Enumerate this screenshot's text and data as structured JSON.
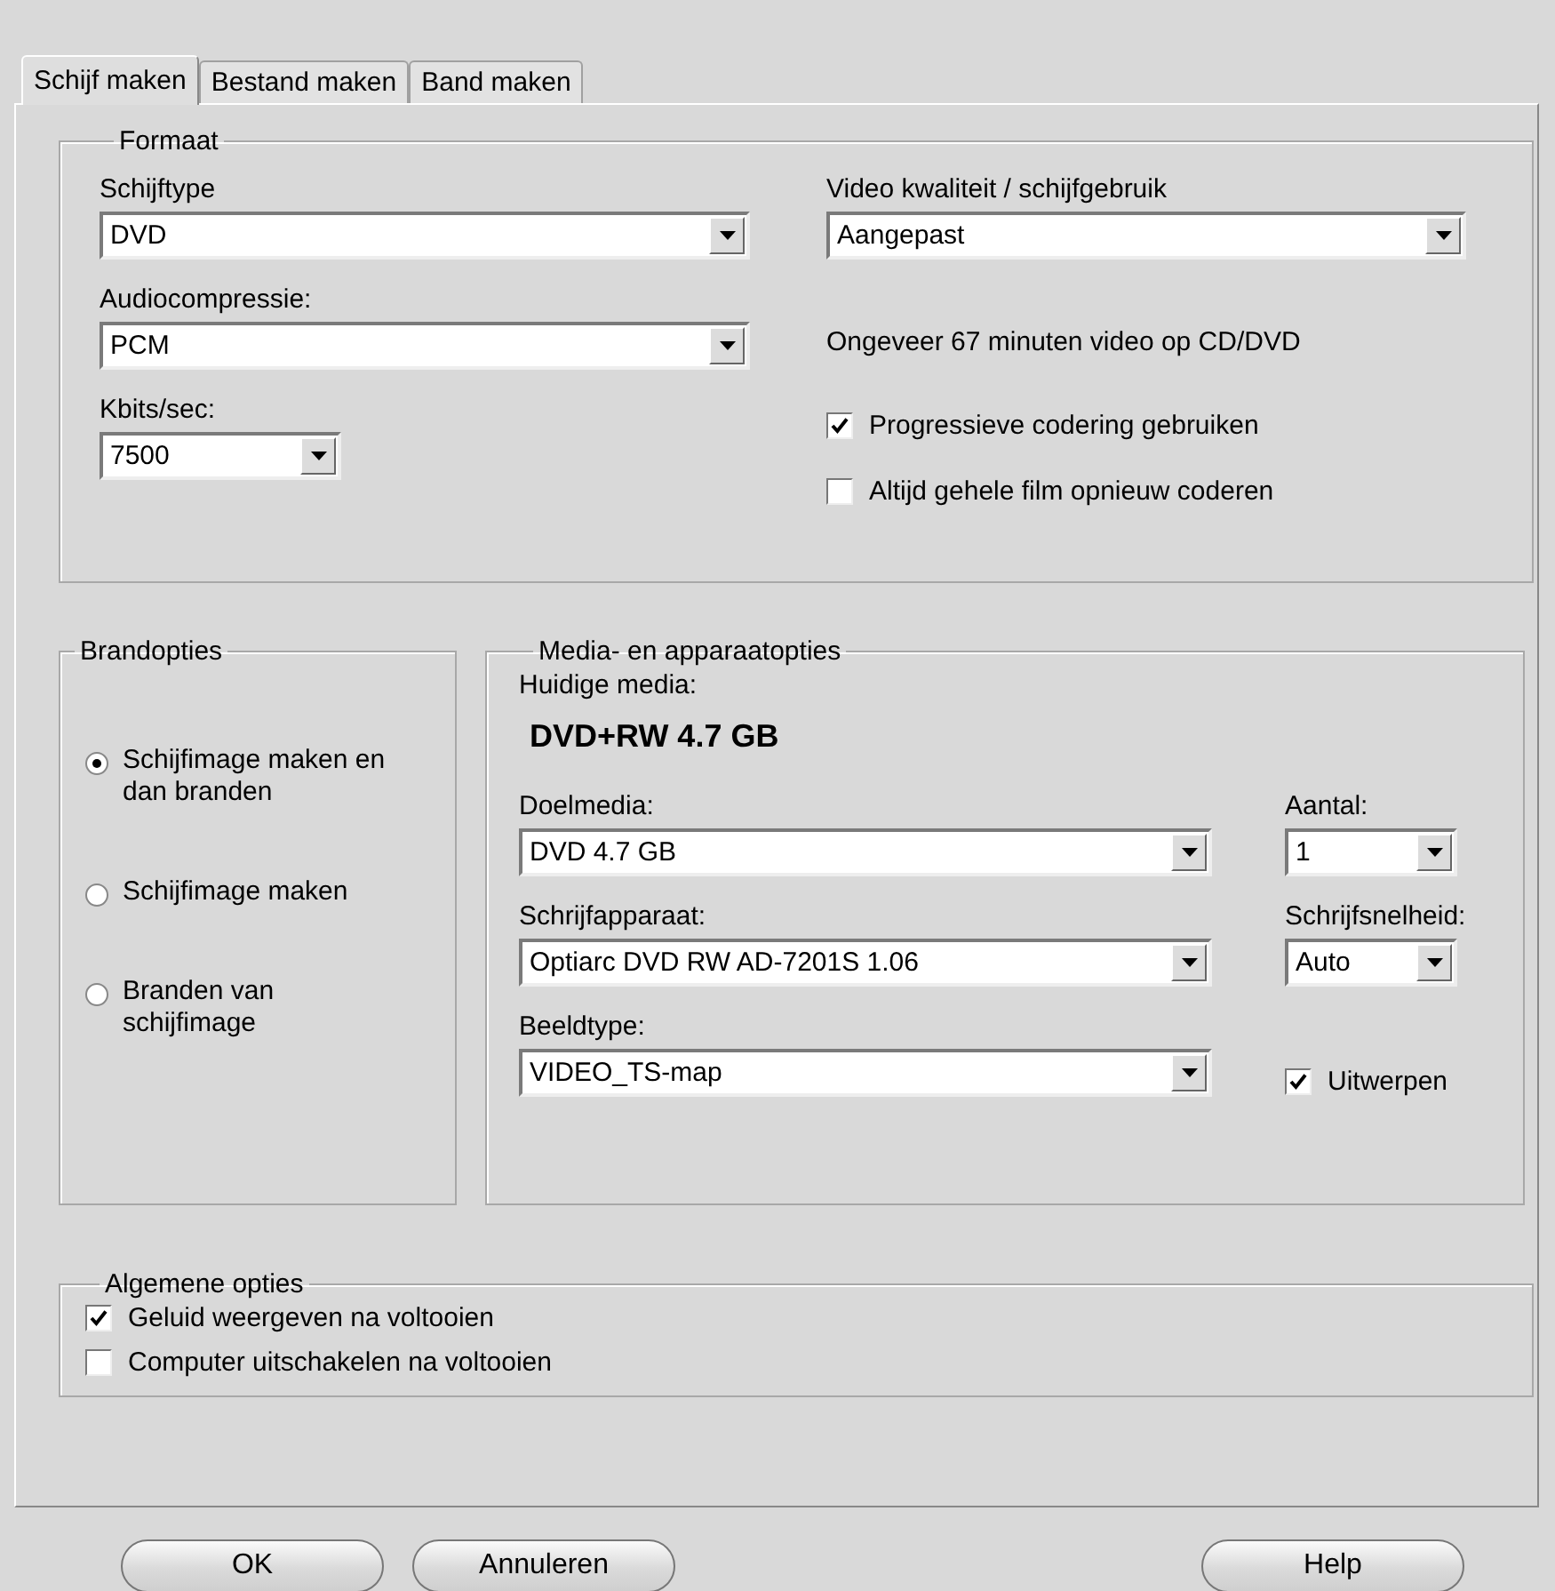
{
  "tabs": [
    {
      "label": "Schijf maken",
      "selected": true
    },
    {
      "label": "Bestand maken",
      "selected": false
    },
    {
      "label": "Band maken",
      "selected": false
    }
  ],
  "format": {
    "title": "Formaat",
    "disc_type": {
      "label": "Schijftype",
      "value": "DVD"
    },
    "audio_compression": {
      "label": "Audiocompressie:",
      "value": "PCM"
    },
    "kbits": {
      "label": "Kbits/sec:",
      "value": "7500"
    },
    "video_quality": {
      "label": "Video kwaliteit / schijfgebruik",
      "value": "Aangepast"
    },
    "estimate": "Ongeveer 67 minuten video op CD/DVD",
    "options": [
      {
        "label": "Progressieve codering gebruiken",
        "checked": true
      },
      {
        "label": "Altijd gehele film opnieuw coderen",
        "checked": false
      }
    ]
  },
  "burn_options": {
    "title": "Brandopties",
    "choices": [
      {
        "label": "Schijfimage maken en dan branden",
        "selected": true
      },
      {
        "label": "Schijfimage maken",
        "selected": false
      },
      {
        "label": "Branden van schijfimage",
        "selected": false
      }
    ]
  },
  "media": {
    "title": "Media- en apparaatopties",
    "current_label": "Huidige media:",
    "current_value": "DVD+RW 4.7 GB",
    "target": {
      "label": "Doelmedia:",
      "value": "DVD 4.7 GB"
    },
    "count": {
      "label": "Aantal:",
      "value": "1"
    },
    "writer": {
      "label": "Schrijfapparaat:",
      "value": "Optiarc DVD RW AD-7201S 1.06"
    },
    "speed": {
      "label": "Schrijfsnelheid:",
      "value": "Auto"
    },
    "image_type": {
      "label": "Beeldtype:",
      "value": "VIDEO_TS-map"
    },
    "eject": {
      "label": "Uitwerpen",
      "checked": true
    }
  },
  "general": {
    "title": "Algemene opties",
    "options": [
      {
        "label": "Geluid weergeven na voltooien",
        "checked": true
      },
      {
        "label": "Computer uitschakelen na voltooien",
        "checked": false
      }
    ]
  },
  "buttons": [
    "OK",
    "Annuleren",
    "Help"
  ]
}
